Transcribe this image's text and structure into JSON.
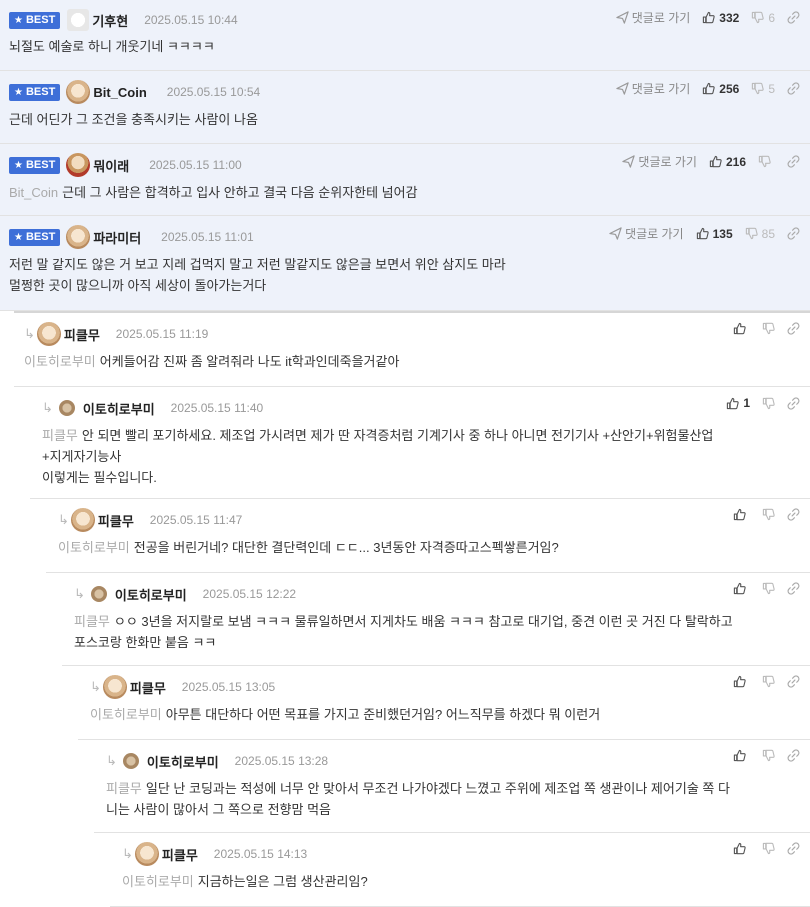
{
  "best_label": "BEST",
  "goto_label": "댓글로 가기",
  "best_comments": [
    {
      "nick": "기후현",
      "date": "2025.05.15 10:44",
      "mention": "",
      "text": "뇌절도 예술로 하니 개웃기네 ㅋㅋㅋㅋ",
      "up": "332",
      "down": "6"
    },
    {
      "nick": "Bit_Coin",
      "date": "2025.05.15 10:54",
      "mention": "",
      "text": "근데 어딘가 그 조건을 충족시키는 사람이 나옴",
      "up": "256",
      "down": "5"
    },
    {
      "nick": "뭐이래",
      "date": "2025.05.15 11:00",
      "mention": "Bit_Coin",
      "text": "근데 그 사람은 합격하고 입사 안하고 결국 다음 순위자한테 넘어감",
      "up": "216",
      "down": ""
    },
    {
      "nick": "파라미터",
      "date": "2025.05.15 11:01",
      "mention": "",
      "text": "저런 말 같지도 않은 거 보고 지레 겁먹지 말고 저런 말같지도 않은글 보면서 위안 삼지도 마라",
      "text2": "멀쩡한 곳이 많으니까 아직 세상이 돌아가는거다",
      "up": "135",
      "down": "85"
    }
  ],
  "replies": [
    {
      "nick": "피클무",
      "date": "2025.05.15 11:19",
      "mention": "이토히로부미",
      "text": "어케들어감 진짜 좀 알려줘라 나도 it학과인데죽을거같아",
      "up": ""
    },
    {
      "nick": "이토히로부미",
      "date": "2025.05.15 11:40",
      "mention": "피클무",
      "text": "안 되면 빨리 포기하세요. 제조업 가시려면 제가 딴 자격증처럼 기계기사 중 하나 아니면 전기기사 +산안기+위험물산업",
      "text2": "+지게자기능사",
      "text3": "이렇게는 필수입니다.",
      "up": "1"
    },
    {
      "nick": "피클무",
      "date": "2025.05.15 11:47",
      "mention": "이토히로부미",
      "text": "전공을 버린거네? 대단한 결단력인데 ㄷㄷ... 3년동안 자격증따고스펙쌓른거임?",
      "up": ""
    },
    {
      "nick": "이토히로부미",
      "date": "2025.05.15 12:22",
      "mention": "피클무",
      "text": "ㅇㅇ 3년을 저지랄로 보냄 ㅋㅋㅋ 물류일하면서 지게차도 배움 ㅋㅋㅋ 참고로 대기업, 중견 이런 곳 거진 다 탈락하고",
      "text2": "포스코랑 한화만 붙음 ㅋㅋ",
      "up": ""
    },
    {
      "nick": "피클무",
      "date": "2025.05.15 13:05",
      "mention": "이토히로부미",
      "text": "아무튼 대단하다 어떤 목표를 가지고 준비했던거임? 어느직무를 하겠다 뭐 이런거",
      "up": ""
    },
    {
      "nick": "이토히로부미",
      "date": "2025.05.15 13:28",
      "mention": "피클무",
      "text": "일단 난 코딩과는 적성에 너무 안 맞아서 무조건 나가야겠다 느꼈고 주위에 제조업 쪽 생관이나 제어기술 쪽 다",
      "text2": "니는 사람이 많아서 그 쪽으로 전향맘 먹음",
      "up": ""
    },
    {
      "nick": "피클무",
      "date": "2025.05.15 14:13",
      "mention": "이토히로부미",
      "text": "지금하는일은 그럼 생산관리임?",
      "up": ""
    }
  ],
  "icons": {
    "best": "star-icon",
    "goto": "send-arrow-icon",
    "up": "thumbs-up-icon",
    "down": "thumbs-down-icon",
    "link": "link-icon",
    "reply": "reply-arrow-icon"
  },
  "colors": {
    "best_badge": "#3e6fd8",
    "best_bg": "#eef2fa",
    "mention": "#aaaaaa",
    "date": "#999999"
  }
}
